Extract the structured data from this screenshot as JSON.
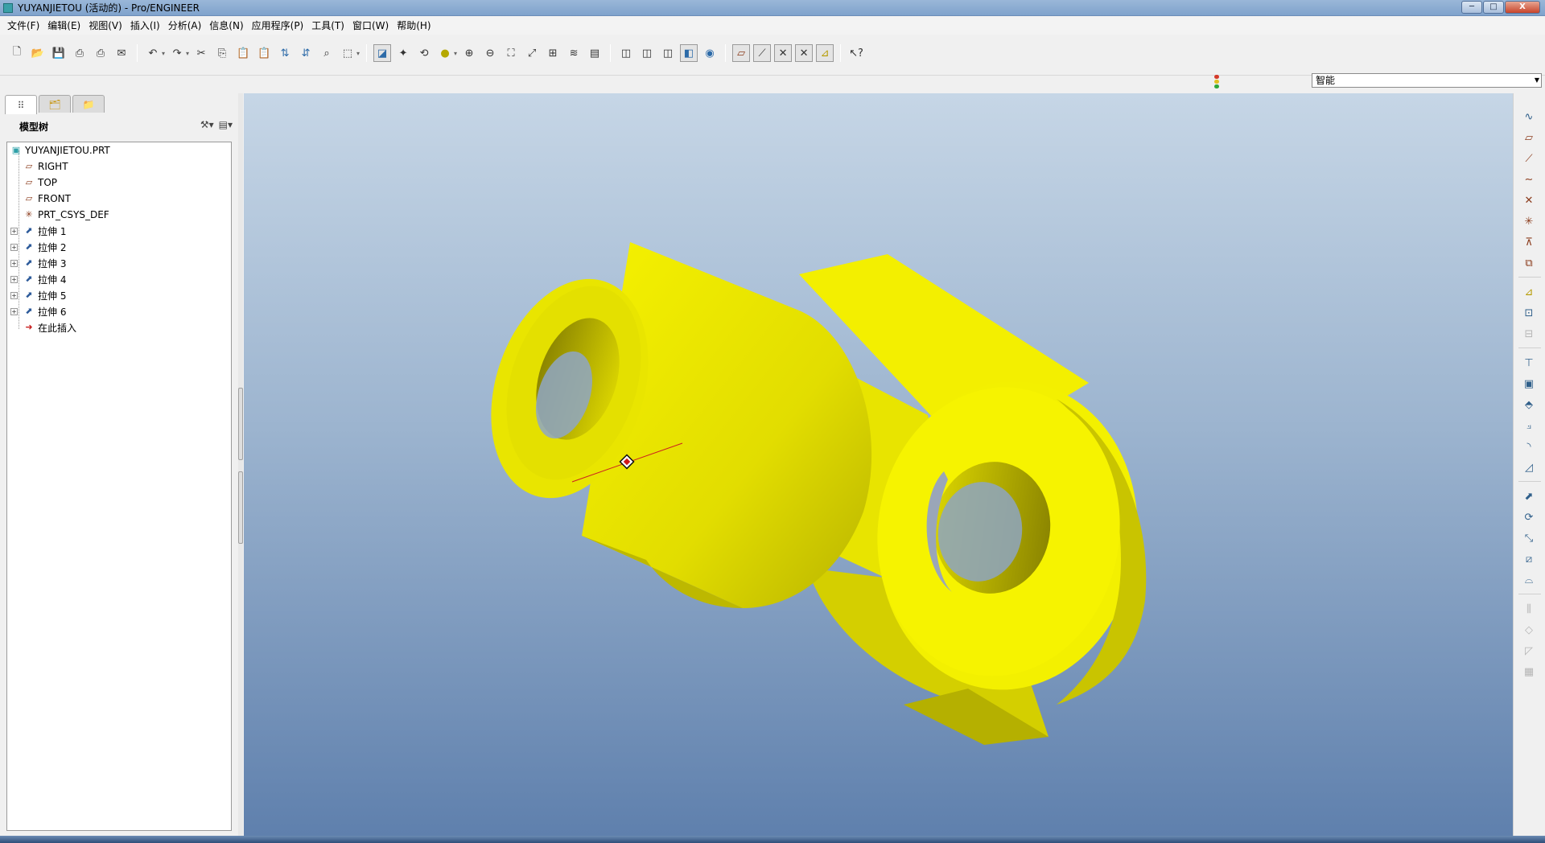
{
  "window": {
    "title": "YUYANJIETOU (活动的) - Pro/ENGINEER",
    "minimize": "─",
    "maximize": "□",
    "close": "X"
  },
  "menu": [
    "文件(F)",
    "编辑(E)",
    "视图(V)",
    "插入(I)",
    "分析(A)",
    "信息(N)",
    "应用程序(P)",
    "工具(T)",
    "窗口(W)",
    "帮助(H)"
  ],
  "filter": {
    "selected": "智能"
  },
  "model_tree": {
    "title": "模型树",
    "root": "YUYANJIETOU.PRT",
    "items": [
      {
        "label": "RIGHT",
        "icon": "datum-plane-icon"
      },
      {
        "label": "TOP",
        "icon": "datum-plane-icon"
      },
      {
        "label": "FRONT",
        "icon": "datum-plane-icon"
      },
      {
        "label": "PRT_CSYS_DEF",
        "icon": "coordinate-system-icon"
      },
      {
        "label": "拉伸 1",
        "icon": "extrude-icon"
      },
      {
        "label": "拉伸 2",
        "icon": "extrude-icon"
      },
      {
        "label": "拉伸 3",
        "icon": "extrude-icon"
      },
      {
        "label": "拉伸 4",
        "icon": "extrude-icon"
      },
      {
        "label": "拉伸 5",
        "icon": "extrude-icon"
      },
      {
        "label": "拉伸 6",
        "icon": "extrude-icon"
      },
      {
        "label": "在此插入",
        "icon": "insert-here-arrow-icon"
      }
    ]
  },
  "colors": {
    "model_yellow": "#f2f200",
    "model_shade": "#c9c400",
    "viewport_top": "#c6d6e6",
    "viewport_bottom": "#5f80ad",
    "axis_red": "#cc1f1f"
  }
}
